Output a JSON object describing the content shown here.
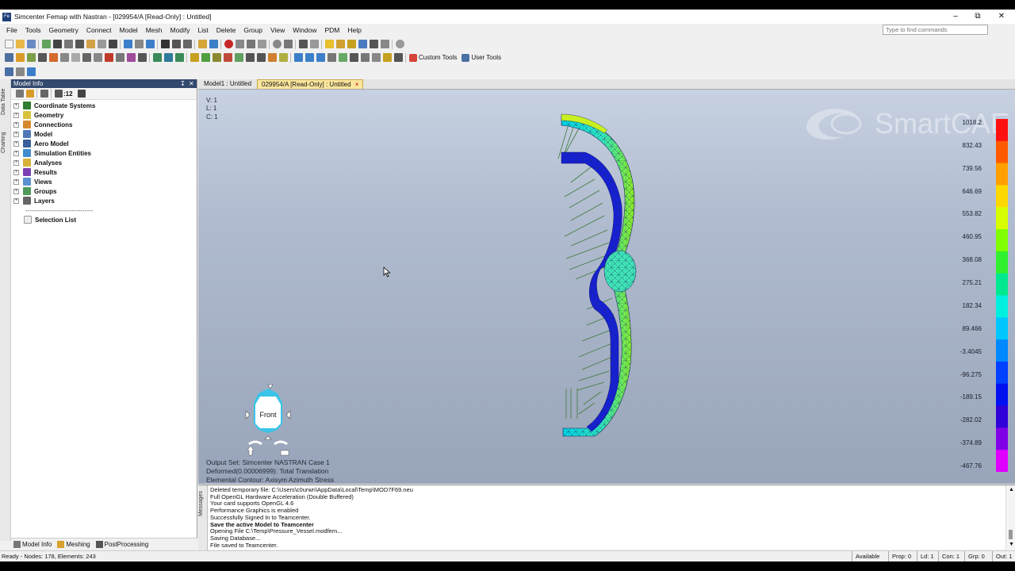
{
  "window": {
    "title": "Simcenter Femap with Nastran - [029954/A [Read-Only] : Untitled]",
    "minimize": "–",
    "maximize": "⧉",
    "close": "✕"
  },
  "menu": [
    "File",
    "Tools",
    "Geometry",
    "Connect",
    "Model",
    "Mesh",
    "Modify",
    "List",
    "Delete",
    "Group",
    "View",
    "Window",
    "PDM",
    "Help"
  ],
  "search": {
    "placeholder": "Type to find commands"
  },
  "toolbar": {
    "custom_tools": "Custom Tools",
    "user_tools": "User Tools"
  },
  "model_info": {
    "title": "Model Info",
    "tree": [
      {
        "label": "Coordinate Systems"
      },
      {
        "label": "Geometry"
      },
      {
        "label": "Connections"
      },
      {
        "label": "Model"
      },
      {
        "label": "Aero Model"
      },
      {
        "label": "Simulation Entities"
      },
      {
        "label": "Analyses"
      },
      {
        "label": "Results"
      },
      {
        "label": "Views"
      },
      {
        "label": "Groups"
      },
      {
        "label": "Layers"
      }
    ],
    "separator": "--------------------------------",
    "selection_list": "Selection List",
    "toolbar_count": ":12"
  },
  "side_tabs": {
    "data_table": "Data Table",
    "charting": "Charting"
  },
  "bottom_tabs": [
    "Model Info",
    "Meshing",
    "PostProcessing"
  ],
  "viewport": {
    "tabs": [
      "Model1 : Untitled",
      "029954/A [Read-Only] : Untitled"
    ],
    "tab_close": "×",
    "corner": [
      "V: 1",
      "L: 1",
      "C: 1"
    ],
    "output_info": [
      "Output Set: Simcenter NASTRAN Case 1",
      "Deformed(0.00006999): Total Translation",
      "Elemental Contour: Axisym Azimuth Stress"
    ],
    "view_cube": "Front",
    "watermark": "SmartCAE",
    "legend_values": [
      "1018.2",
      "832.43",
      "739.56",
      "646.69",
      "553.82",
      "460.95",
      "368.08",
      "275.21",
      "182.34",
      "89.466",
      "-3.4045",
      "-96.275",
      "-189.15",
      "-282.02",
      "-374.89",
      "-467.76"
    ],
    "legend_colors": [
      "#ff1010",
      "#ff5a00",
      "#ffa000",
      "#ffd800",
      "#d8ff00",
      "#80ff00",
      "#30f030",
      "#00e890",
      "#00f0e0",
      "#00c8ff",
      "#0088ff",
      "#0040ff",
      "#0010f0",
      "#3000d8",
      "#8000e8",
      "#e000ff"
    ]
  },
  "messages": {
    "tab": "Messages",
    "lines": [
      {
        "text": "Deleted temporary file: C:\\Users\\c0urwn\\AppData\\Local\\Temp\\MOD7F69.neu",
        "bold": false
      },
      {
        "text": "Full OpenGL Hardware Acceleration (Double Buffered)",
        "bold": false
      },
      {
        "text": "Your card supports OpenGL 4.6",
        "bold": false
      },
      {
        "text": "Performance Graphics is enabled",
        "bold": false
      },
      {
        "text": "Successfully Signed In to Teamcenter.",
        "bold": false
      },
      {
        "text": "Save the active Model to Teamcenter",
        "bold": true
      },
      {
        "text": "Opening File C:\\Temp\\Pressure_Vessel.modfem...",
        "bold": false
      },
      {
        "text": "Saving Database...",
        "bold": false
      },
      {
        "text": "File saved to Teamcenter.",
        "bold": false
      }
    ]
  },
  "status": {
    "left": "Ready - Nodes: 178,  Elements: 243",
    "available": "Available",
    "prop": "Prop: 0",
    "ld": "Ld: 1",
    "con": "Con: 1",
    "grp": "Grp: 0",
    "out": "Out: 1"
  }
}
